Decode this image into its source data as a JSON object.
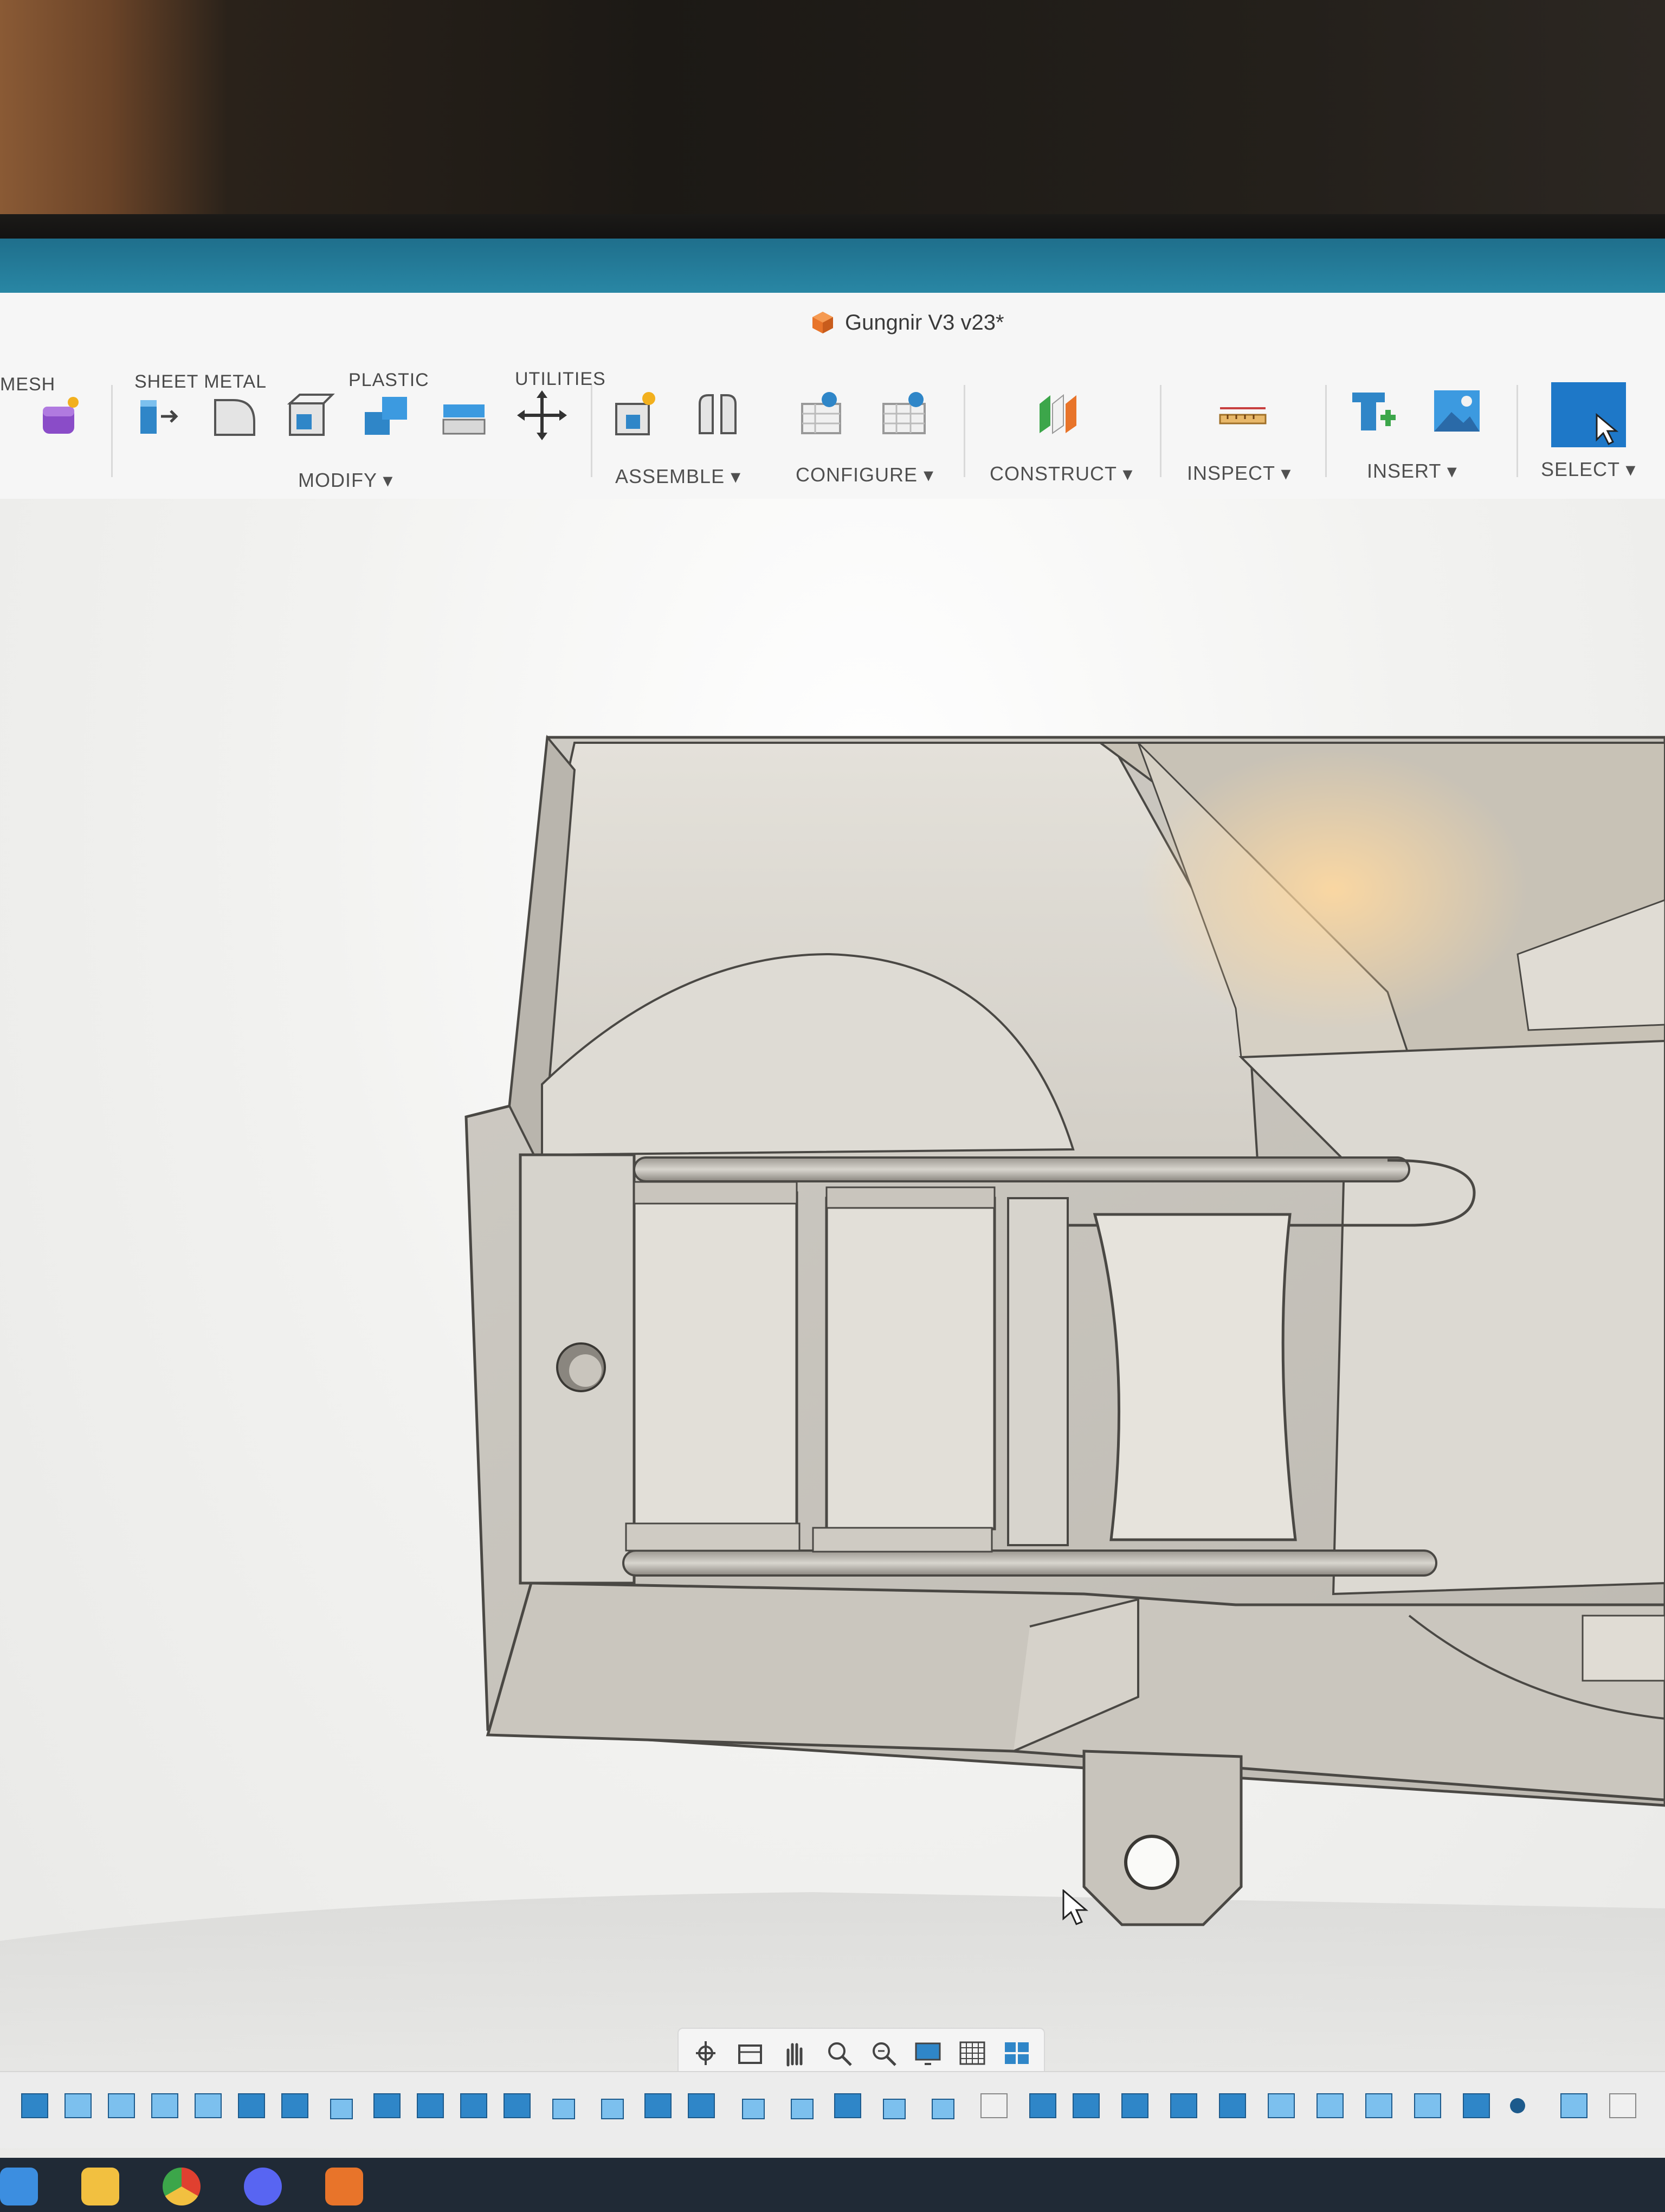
{
  "window": {
    "title": "Gungnir V3 v23*"
  },
  "toolbar": {
    "tabs": [
      "MESH",
      "SHEET METAL",
      "PLASTIC",
      "UTILITIES"
    ],
    "groups": {
      "modify": "MODIFY",
      "assemble": "ASSEMBLE",
      "configure": "CONFIGURE",
      "construct": "CONSTRUCT",
      "inspect": "INSPECT",
      "insert": "INSERT",
      "select": "SELECT"
    },
    "dropdown_glyph": "▾"
  },
  "icons": [
    "create-form-icon",
    "press-pull-icon",
    "fillet-icon",
    "shell-icon",
    "combine-icon",
    "replace-face-icon",
    "move-icon",
    "new-component-icon",
    "joint-icon",
    "configure-table-icon",
    "configure-rule-icon",
    "offset-plane-icon",
    "measure-icon",
    "insert-derive-icon",
    "insert-canvas-icon",
    "select-icon"
  ],
  "navbar_icons": [
    "orbit-icon",
    "look-at-icon",
    "pan-icon",
    "zoom-icon",
    "fit-icon",
    "display-settings-icon",
    "grid-icon",
    "viewports-icon"
  ],
  "colors": {
    "accent": "#2a8aa8",
    "icon_blue": "#2f86c8",
    "select_blue": "#1e78c8",
    "model_face": "#d9d6cf",
    "model_edge": "#4a4844"
  }
}
